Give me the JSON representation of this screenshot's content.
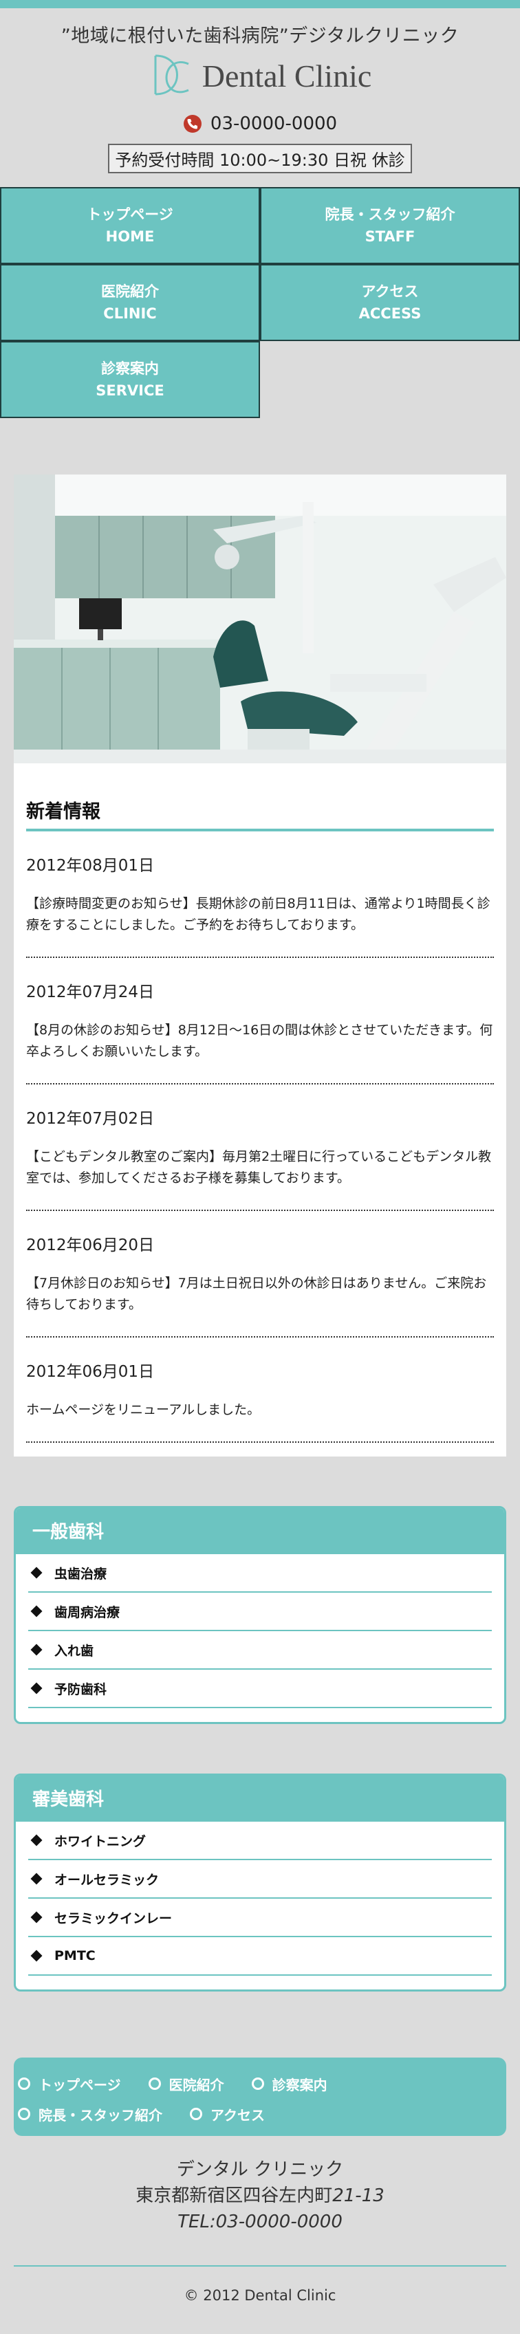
{
  "colors": {
    "accent": "#6cc4c1",
    "nav_border": "#1f3f3f",
    "background": "#dcdcdc"
  },
  "header": {
    "tagline": "”地域に根付いた歯科病院”デジタルクリニック",
    "logo_text": "Dental Clinic",
    "logo_icon": "dc-monogram-logo",
    "phone": "03-0000-0000",
    "phone_icon": "phone-icon",
    "hours": "予約受付時間 10:00~19:30 日祝 休診"
  },
  "nav": [
    {
      "ja": "トップページ",
      "en": "HOME"
    },
    {
      "ja": "院長・スタッフ紹介",
      "en": "STAFF"
    },
    {
      "ja": "医院紹介",
      "en": "CLINIC"
    },
    {
      "ja": "アクセス",
      "en": "ACCESS"
    },
    {
      "ja": "診察案内",
      "en": "SERVICE"
    }
  ],
  "news": {
    "title": "新着情報",
    "items": [
      {
        "date": "2012年08月01日",
        "body": "【診療時間変更のお知らせ】長期休診の前日8月11日は、通常より1時間長く診療をすることにしました。ご予約をお待ちしております。"
      },
      {
        "date": "2012年07月24日",
        "body": "【8月の休診のお知らせ】8月12日〜16日の間は休診とさせていただきます。何卒よろしくお願いいたします。"
      },
      {
        "date": "2012年07月02日",
        "body": "【こどもデンタル教室のご案内】毎月第2土曜日に行っているこどもデンタル教室では、参加してくださるお子様を募集しております。"
      },
      {
        "date": "2012年06月20日",
        "body": "【7月休診日のお知らせ】7月は土日祝日以外の休診日はありません。ご来院お待ちしております。"
      },
      {
        "date": "2012年06月01日",
        "body": "ホームページをリニューアルしました。"
      }
    ]
  },
  "general": {
    "title": "一般歯科",
    "items": [
      "虫歯治療",
      "歯周病治療",
      "入れ歯",
      "予防歯科"
    ]
  },
  "cosmetic": {
    "title": "審美歯科",
    "items": [
      "ホワイトニング",
      "オールセラミック",
      "セラミックインレー",
      "PMTC"
    ]
  },
  "footer_nav": [
    "トップページ",
    "医院紹介",
    "診察案内",
    "院長・スタッフ紹介",
    "アクセス"
  ],
  "address": {
    "name": "デンタル クリニック",
    "street_prefix": "東京都新宿区四谷左内町",
    "street_number": "21-13",
    "tel": "TEL:03-0000-0000"
  },
  "copyright": "© 2012 Dental Clinic"
}
